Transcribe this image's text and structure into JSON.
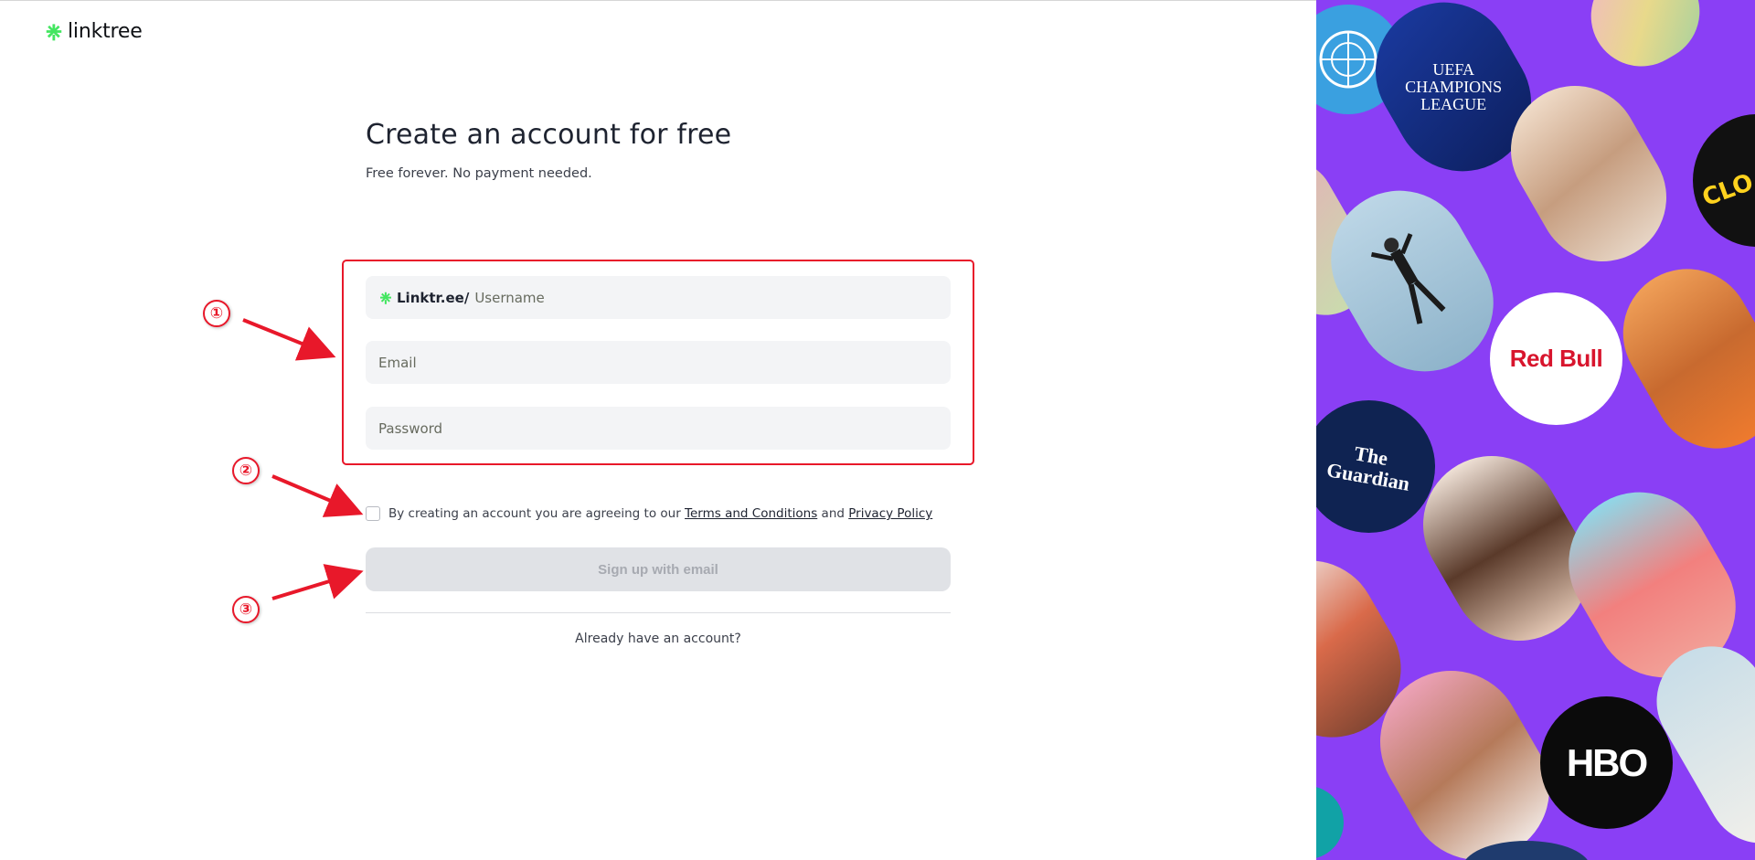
{
  "logo": {
    "text": "linktree"
  },
  "heading": {
    "title": "Create an account for free",
    "subtitle": "Free forever. No payment needed."
  },
  "form": {
    "username_prefix": "Linktr.ee/",
    "username_placeholder": "Username",
    "email_placeholder": "Email",
    "password_placeholder": "Password"
  },
  "terms": {
    "text_before": "By creating an account you are agreeing to our ",
    "terms_link": "Terms and Conditions",
    "text_middle": " and ",
    "privacy_link": "Privacy Policy",
    "checked": false
  },
  "signup_button": {
    "label": "Sign up with email"
  },
  "login_link": {
    "label": "Already have an account?"
  },
  "annotations": {
    "marker_1": "①",
    "marker_2": "②",
    "marker_3": "③"
  },
  "collage": {
    "champions_league": "UEFA CHAMPIONS LEAGUE",
    "red_bull": "Red Bull",
    "guardian": "The Guardian",
    "hbo": "HBO",
    "clothe": "CLO THE"
  },
  "colors": {
    "brand_green": "#43e660",
    "annotation_red": "#e8182a",
    "collage_purple": "#8a3ff5",
    "field_bg": "#f3f4f6",
    "button_disabled": "#e0e2e6"
  }
}
